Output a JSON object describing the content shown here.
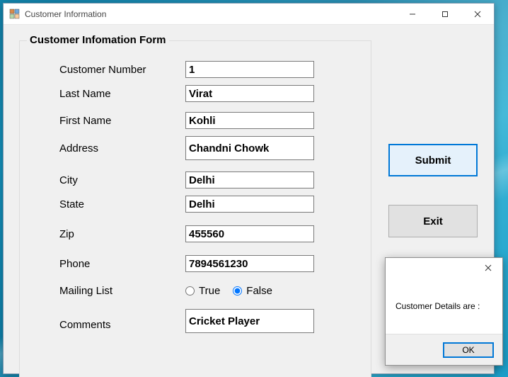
{
  "window": {
    "title": "Customer Information"
  },
  "form": {
    "legend": "Customer Infomation Form",
    "labels": {
      "customer_number": "Customer Number",
      "last_name": "Last Name",
      "first_name": "First Name",
      "address": "Address",
      "city": "City",
      "state": "State",
      "zip": "Zip",
      "phone": "Phone",
      "mailing_list": "Mailing List",
      "comments": "Comments"
    },
    "values": {
      "customer_number": "1",
      "last_name": "Virat",
      "first_name": "Kohli",
      "address": "Chandni Chowk",
      "city": "Delhi",
      "state": "Delhi",
      "zip": "455560",
      "phone": "7894561230",
      "comments": "Cricket Player"
    },
    "mailing_list": {
      "true_label": "True",
      "false_label": "False",
      "selected": "false"
    }
  },
  "buttons": {
    "submit": "Submit",
    "exit": "Exit"
  },
  "dialog": {
    "message": "Customer Details are :",
    "ok": "OK"
  }
}
